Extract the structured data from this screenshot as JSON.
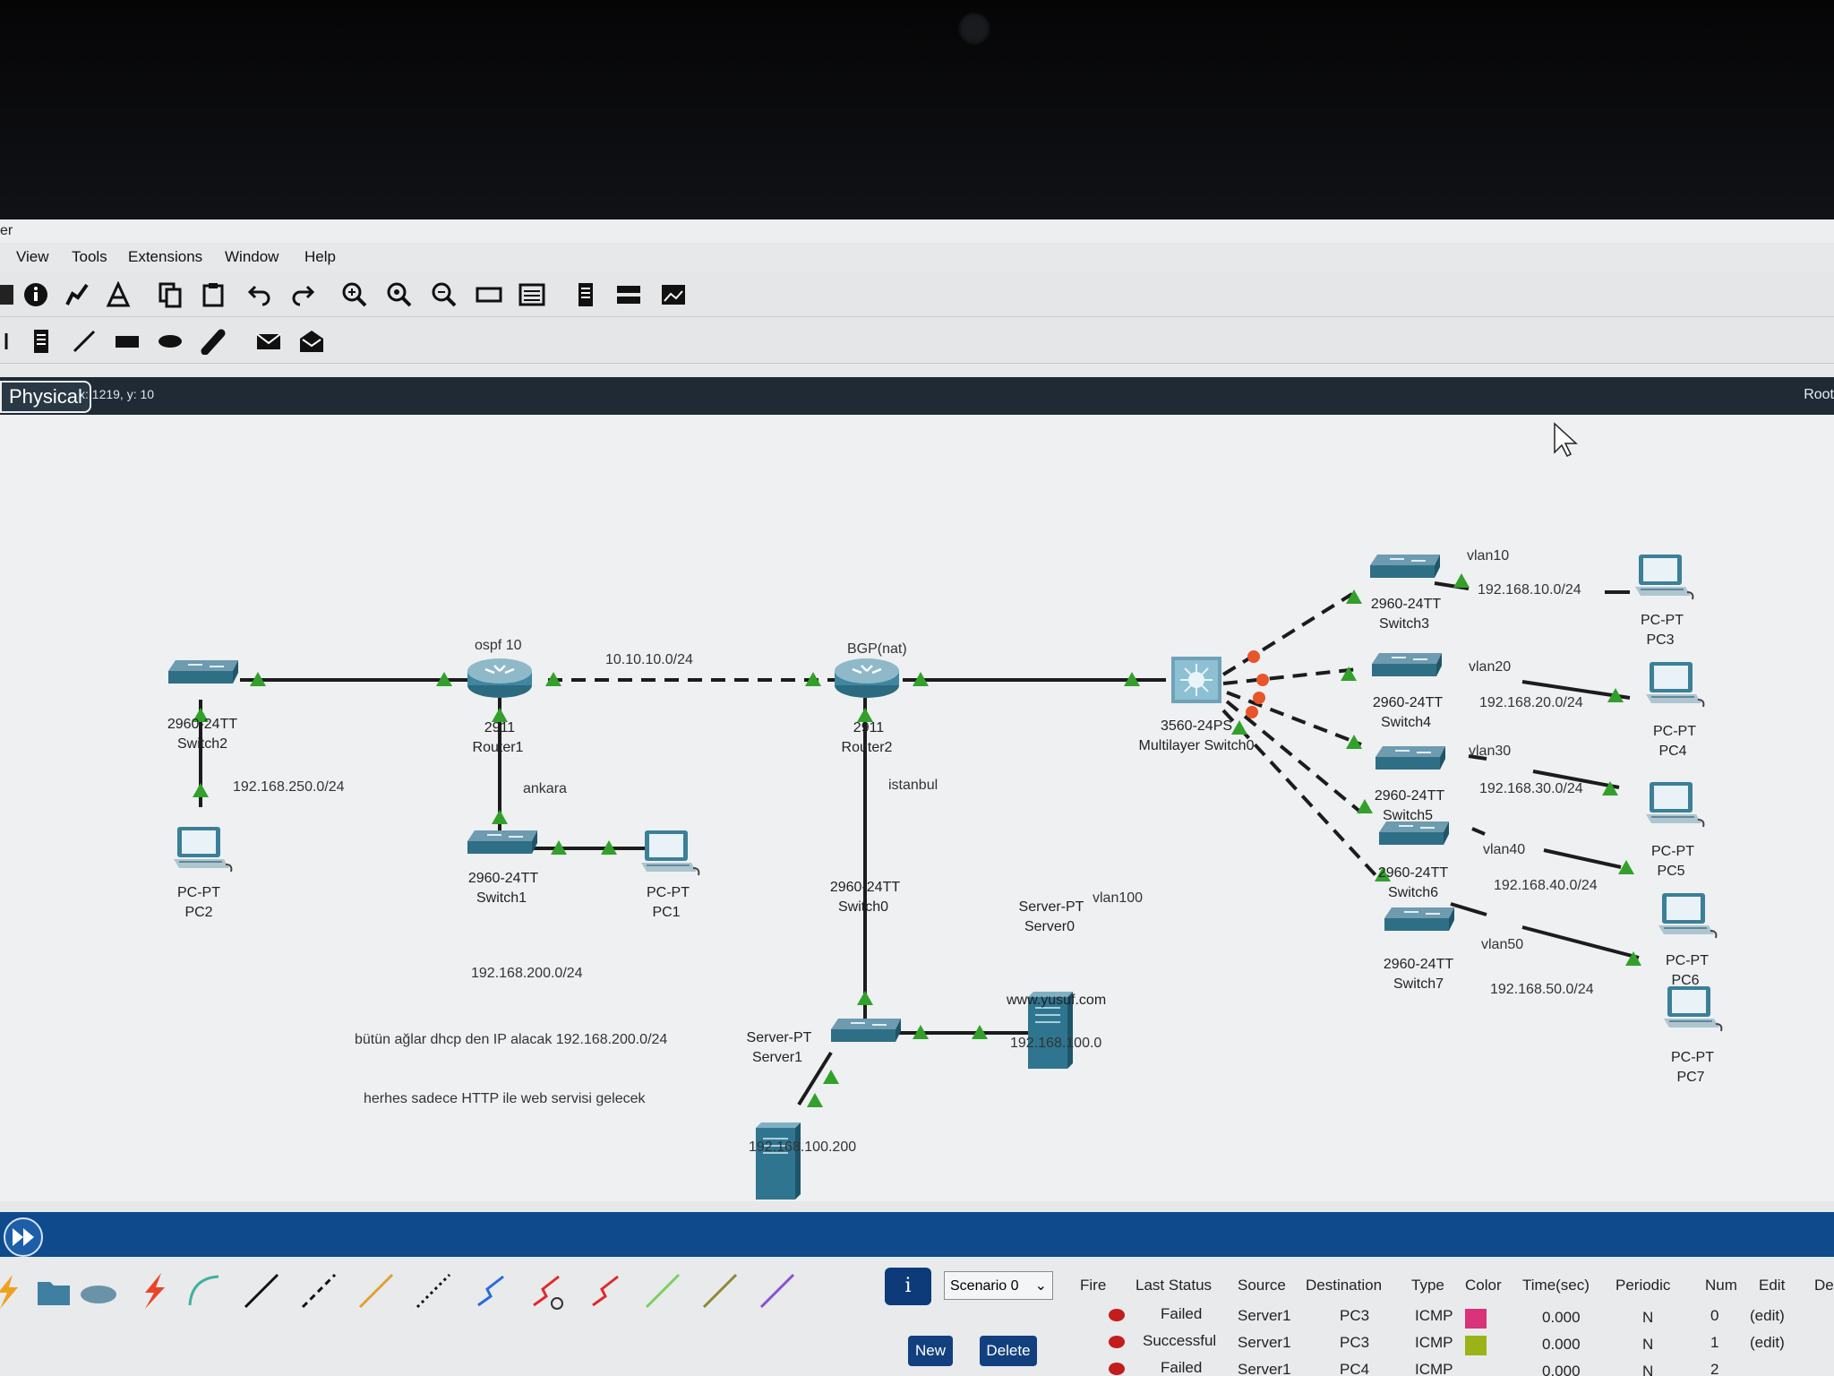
{
  "window": {
    "title_fragment": "er"
  },
  "menu": {
    "items": [
      "View",
      "Tools",
      "Extensions",
      "Window",
      "Help"
    ]
  },
  "workspace_bar": {
    "mode_tab": "Physical",
    "cursor_readout": "x: 1219, y: 10",
    "root_label": "Root"
  },
  "labels": {
    "ospf": "ospf 10",
    "link_10": "10.10.10.0/24",
    "bgp": "BGP(nat)",
    "net_250": "192.168.250.0/24",
    "ankara": "ankara",
    "istanbul": "istanbul",
    "net_200": "192.168.200.0/24",
    "note1": "bütün ağlar dhcp den IP alacak 192.168.200.0/24",
    "note2": "herhes sadece HTTP ile web servisi gelecek",
    "vlan100": "vlan100",
    "domain": "www.yusuf.com",
    "net_100": "192.168.100.0",
    "server1_ip": "192.168.100.200",
    "vlan10": "vlan10",
    "net_10": "192.168.10.0/24",
    "vlan20": "vlan20",
    "net_20": "192.168.20.0/24",
    "vlan30": "vlan30",
    "net_30": "192.168.30.0/24",
    "vlan40": "vlan40",
    "net_40": "192.168.40.0/24",
    "vlan50": "vlan50",
    "net_50": "192.168.50.0/24"
  },
  "devices": {
    "switch2": {
      "model": "2960-24TT",
      "name": "Switch2"
    },
    "router1": {
      "model": "2911",
      "name": "Router1"
    },
    "router2": {
      "model": "2911",
      "name": "Router2"
    },
    "switch1": {
      "model": "2960-24TT",
      "name": "Switch1"
    },
    "switch0": {
      "model": "2960-24TT",
      "name": "Switch0"
    },
    "server0": {
      "model": "Server-PT",
      "name": "Server0"
    },
    "server1": {
      "model": "Server-PT",
      "name": "Server1"
    },
    "pc1": {
      "model": "PC-PT",
      "name": "PC1"
    },
    "pc2": {
      "model": "PC-PT",
      "name": "PC2"
    },
    "mls": {
      "model": "3560-24PS",
      "name": "Multilayer Switch0"
    },
    "switch3": {
      "model": "2960-24TT",
      "name": "Switch3"
    },
    "switch4": {
      "model": "2960-24TT",
      "name": "Switch4"
    },
    "switch5": {
      "model": "2960-24TT",
      "name": "Switch5"
    },
    "switch6": {
      "model": "2960-24TT",
      "name": "Switch6"
    },
    "switch7": {
      "model": "2960-24TT",
      "name": "Switch7"
    },
    "pc3": {
      "model": "PC-PT",
      "name": "PC3"
    },
    "pc4": {
      "model": "PC-PT",
      "name": "PC4"
    },
    "pc5": {
      "model": "PC-PT",
      "name": "PC5"
    },
    "pc6": {
      "model": "PC-PT",
      "name": "PC6"
    },
    "pc7": {
      "model": "PC-PT",
      "name": "PC7"
    }
  },
  "scenario": {
    "selected": "Scenario 0",
    "new_label": "New",
    "delete_label": "Delete"
  },
  "events": {
    "headers": [
      "Fire",
      "Last Status",
      "Source",
      "Destination",
      "Type",
      "Color",
      "Time(sec)",
      "Periodic",
      "Num",
      "Edit",
      "Delete"
    ],
    "rows": [
      {
        "status": "Failed",
        "source": "Server1",
        "destination": "PC3",
        "type": "ICMP",
        "color": "#d9337a",
        "time": "0.000",
        "periodic": "N",
        "num": "0",
        "edit": "(edit)"
      },
      {
        "status": "Successful",
        "source": "Server1",
        "destination": "PC3",
        "type": "ICMP",
        "color": "#9bb318",
        "time": "0.000",
        "periodic": "N",
        "num": "1",
        "edit": "(edit)"
      },
      {
        "status": "Failed",
        "source": "Server1",
        "destination": "PC4",
        "type": "ICMP",
        "color": "",
        "time": "0.000",
        "periodic": "N",
        "num": "2",
        "edit": ""
      }
    ]
  }
}
